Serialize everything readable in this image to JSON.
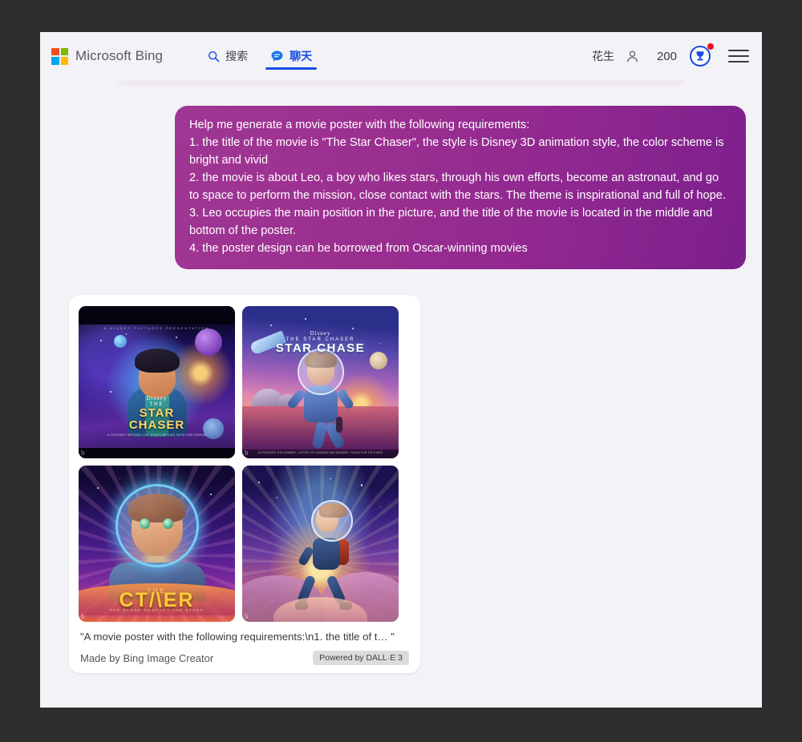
{
  "header": {
    "brand": "Microsoft Bing",
    "nav": [
      {
        "label": "搜索",
        "icon": "search-icon",
        "active": false
      },
      {
        "label": "聊天",
        "icon": "chat-bubble-icon",
        "active": true
      }
    ],
    "user_name": "花生",
    "points": "200",
    "rewards_icon": "rewards-trophy-icon",
    "has_notification": true,
    "menu_icon": "hamburger-menu-icon"
  },
  "prompt": {
    "lines": [
      "Help me generate a movie poster with the following requirements:",
      "1. the title of the movie is \"The Star Chaser\", the style is Disney 3D animation style, the color scheme is bright and vivid",
      "2. the movie is about Leo, a boy who likes stars, through his own efforts, become an astronaut, and go to space to perform the mission, close contact with the stars. The theme is inspirational and full of hope.",
      "3. Leo occupies the main position in the picture, and the title of the movie is located in the middle and bottom of the poster.",
      "4. the poster design can be borrowed from Oscar-winning movies"
    ]
  },
  "results": {
    "posters": [
      {
        "alt": "Cosmic blue poster, boy with dark hair in space",
        "disney": "Disney",
        "the": "THE",
        "title": "STAR",
        "title2": "CHASER",
        "credits": "A JOURNEY BEYOND THE STARS BEGINS WITH ONE DREAM",
        "top_credits": "A DISNEY PICTURES PRESENTATION"
      },
      {
        "alt": "Astronaut boy leaping over alien sunset landscape",
        "disney": "Disney",
        "the": "THE STAR CHASER",
        "title": "STAR CHASE",
        "credits": "IN THEATERS THIS SUMMER  ·  A STORY OF COURAGE AND WONDER  ·  REACH FOR THE STARS"
      },
      {
        "alt": "Close-up of boy in glowing space helmet",
        "the": "THE",
        "title": "CT/\\ER",
        "sub": "THE CLOSE CONTACT THE STARS"
      },
      {
        "alt": "Boy in helmet walking across glowing clouds"
      }
    ],
    "caption": "\"A movie poster with the following requirements:\\n1. the title of t… \"",
    "made_by": "Made by Bing Image Creator",
    "badge": "Powered by DALL·E 3"
  },
  "colors": {
    "accent_blue": "#174ae4",
    "bubble_from": "#a03794",
    "bubble_to": "#7c1f8c",
    "notification_red": "#e81123",
    "frame": "#2e2e2e"
  }
}
